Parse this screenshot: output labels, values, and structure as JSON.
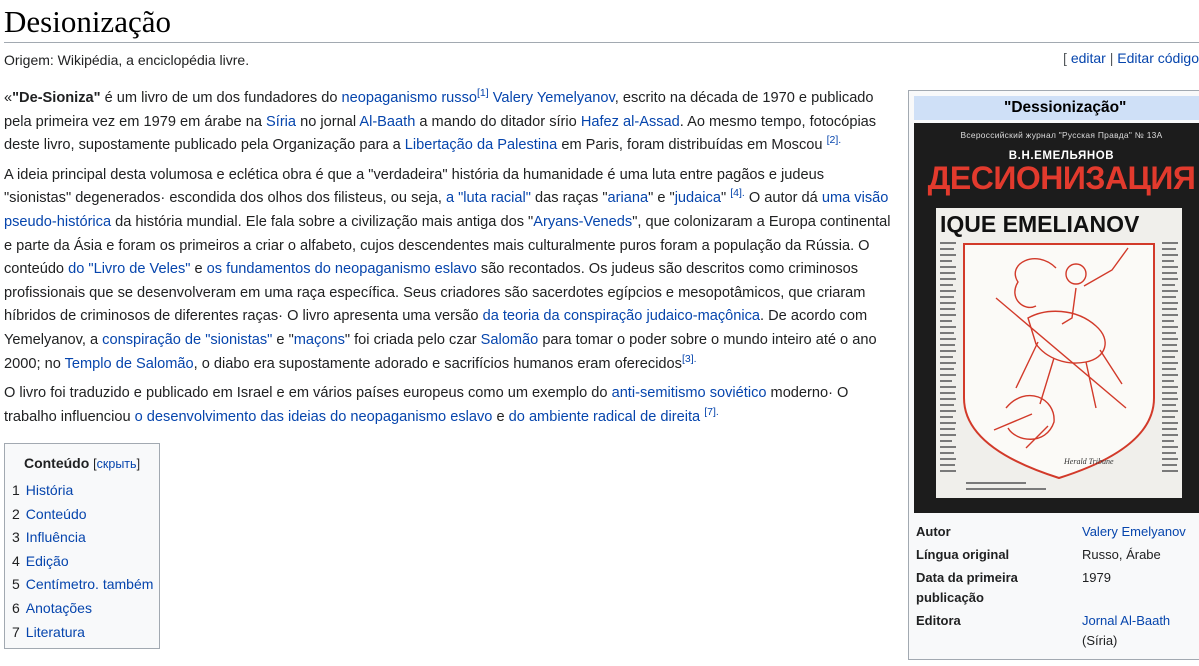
{
  "page": {
    "title": "Desionização",
    "origin": "Origem: Wikipédia, a enciclopédia livre.",
    "edit_links": {
      "open": "[",
      "edit": "editar",
      "sep": "|",
      "edit_code": "Editar código"
    }
  },
  "article": {
    "p1": {
      "t1": "«",
      "bold": "\"De-Sioniza\"",
      "t2": " é um livro de um dos fundadores do ",
      "l1": "neopaganismo russo",
      "s1": "[1]",
      "t3": " ",
      "l2": "Valery Yemelyanov",
      "t4": ", escrito na década de 1970 e publicado pela primeira vez em 1979 em árabe na ",
      "l3": "Síria",
      "t5": " no jornal ",
      "l4": "Al-Baath",
      "t6": " a mando do ditador sírio ",
      "l5": "Hafez al-Assad",
      "t7": ". Ao mesmo tempo, fotocópias deste livro, supostamente publicado pela Organização para a ",
      "l6": "Libertação da Palestina",
      "t8": " em Paris, foram distribuídas em Moscou ",
      "s2": "[2]."
    },
    "p2": {
      "t1": "A ideia principal desta volumosa e eclética obra é que a \"verdadeira\" história da humanidade é uma luta entre pagãos e judeus \"sionistas\" degenerados· escondida dos olhos dos filisteus, ou seja, ",
      "l1": "a \"luta racial\"",
      "t2": " das raças \"",
      "l2": "ariana",
      "t3": "\" e \"",
      "l3": "judaica",
      "t4": "\" ",
      "s1": "[4].",
      "t5": " O autor dá ",
      "l4": "uma visão pseudo-histórica",
      "t6": " da história mundial. Ele fala sobre a civilização mais antiga dos \"",
      "l5": "Aryans-Veneds",
      "t7": "\", que colonizaram a Europa continental e parte da Ásia e foram os primeiros a criar o alfabeto, cujos descendentes mais culturalmente puros foram a população da Rússia. O conteúdo ",
      "l6": "do \"Livro de Veles\"",
      "t8": " e ",
      "l7": "os fundamentos do neopaganismo eslavo",
      "t9": " são recontados. Os judeus são descritos como criminosos profissionais que se desenvolveram em uma raça específica. Seus criadores são sacerdotes egípcios e mesopotâmicos, que criaram híbridos de criminosos de diferentes raças· O livro apresenta uma versão ",
      "l8": "da teoria da conspiração judaico-maçônica",
      "t10": ". De acordo com Yemelyanov, a ",
      "l9": "conspiração de \"sionistas\"",
      "t11": " e \"",
      "l10": "maçons",
      "t12": "\" foi criada pelo czar ",
      "l11": "Salomão",
      "t13": " para tomar o poder sobre o mundo inteiro até o ano 2000; no ",
      "l12": "Templo de Salomão",
      "t14": ", o diabo era supostamente adorado e sacrifícios humanos eram oferecidos",
      "s2": "[3]."
    },
    "p3": {
      "t1": "O livro foi traduzido e publicado em Israel e em vários países europeus como um exemplo do ",
      "l1": "anti-semitismo soviético",
      "t2": " moderno· O trabalho influenciou ",
      "l2": "o desenvolvimento das ideias do neopaganismo eslavo",
      "t3": " e ",
      "l3": "do ambiente radical de direita",
      "t4": " ",
      "s1": "[7]."
    }
  },
  "toc": {
    "title": "Conteúdo",
    "toggle_open": "[",
    "toggle": "скрыть",
    "toggle_close": "]",
    "items": [
      {
        "num": "1",
        "label": "História"
      },
      {
        "num": "2",
        "label": "Conteúdo"
      },
      {
        "num": "3",
        "label": "Influência"
      },
      {
        "num": "4",
        "label": "Edição"
      },
      {
        "num": "5",
        "label": "Centímetro. também"
      },
      {
        "num": "6",
        "label": "Anotações"
      },
      {
        "num": "7",
        "label": "Literatura"
      }
    ]
  },
  "infobox": {
    "title": "\"Dessionização\"",
    "cover": {
      "top_line": "Всероссийский журнал \"Русская Правда\" № 13А",
      "author": "В.Н.ЕМЕЛЬЯНОВ",
      "title": "ДЕСИОНИЗАЦИЯ",
      "newspaper_label": "IQUE EMELIANOV",
      "newspaper_credit": "Herald Tribune"
    },
    "rows": [
      {
        "label": "Autor",
        "value": "Valery Emelyanov",
        "value_suffix": "",
        "link": true
      },
      {
        "label": "Língua original",
        "value": "Russo, Árabe",
        "value_suffix": "",
        "link": false
      },
      {
        "label": "Data da primeira publicação",
        "value": "1979",
        "value_suffix": "",
        "link": false
      },
      {
        "label": "Editora",
        "value": "Jornal Al-Baath",
        "value_suffix": "(Síria)",
        "link": true
      }
    ]
  },
  "colors": {
    "link": "#0645ad",
    "infobox_title_bg": "#cfe0f7",
    "cover_title_red": "#e23a2d"
  }
}
